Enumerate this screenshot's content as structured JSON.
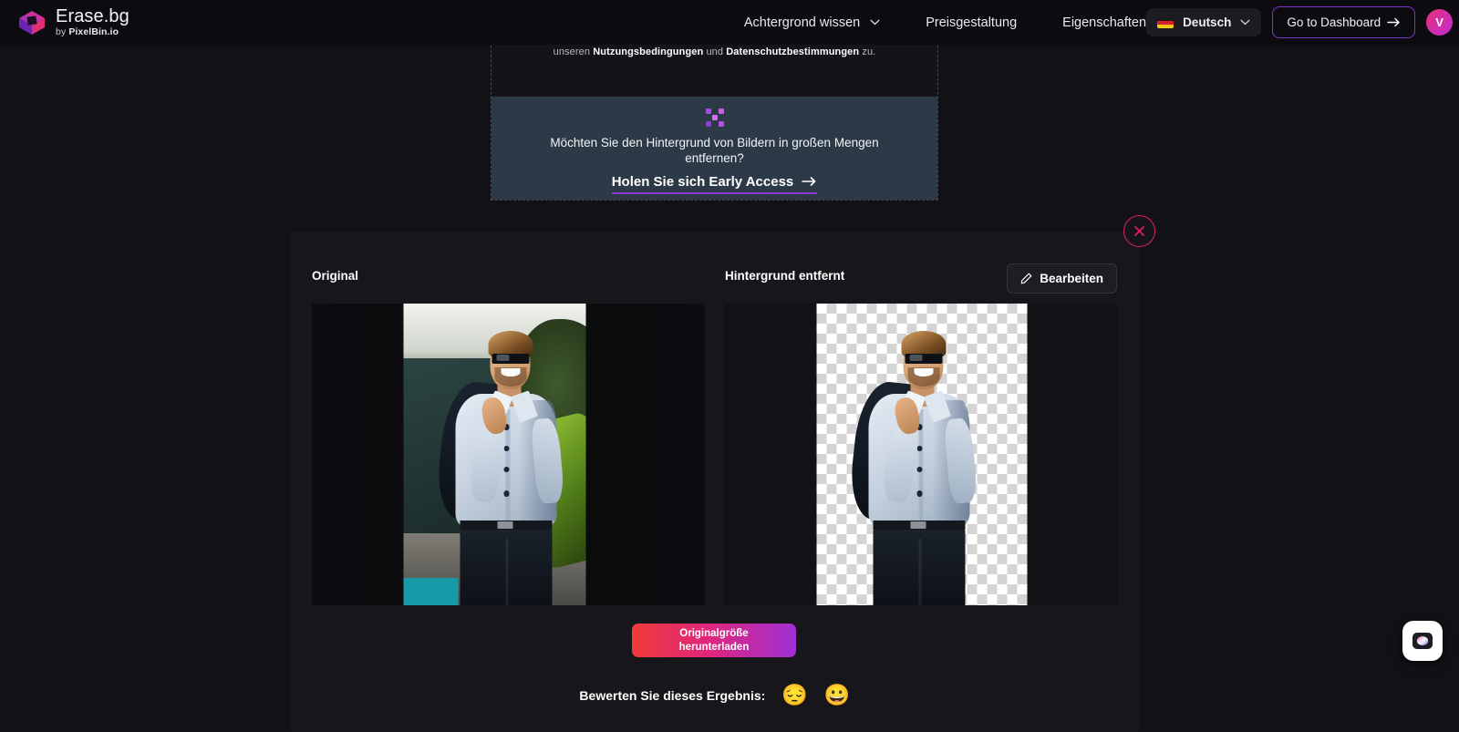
{
  "brand": {
    "name": "Erase.bg",
    "sub_prefix": "by ",
    "sub_name": "PixelBin.io",
    "logo_icon": "erasebg-logo-icon"
  },
  "nav": {
    "items": [
      {
        "label": "Achtergrond wissen",
        "has_dropdown": true,
        "icon": "chevron-down-icon"
      },
      {
        "label": "Preisgestaltung",
        "has_dropdown": false
      },
      {
        "label": "Eigenschaften",
        "has_dropdown": false
      }
    ]
  },
  "header_right": {
    "language": {
      "value": "Deutsch",
      "flag": "german-flag-icon",
      "chevron": "chevron-down-icon"
    },
    "dashboard_button": {
      "label": "Go to Dashboard",
      "icon": "arrow-right-icon",
      "border_color": "#7b35c4"
    },
    "avatar": {
      "initial": "V",
      "gradient_from": "#e8317b",
      "gradient_to": "#c02ad0"
    }
  },
  "dropzone": {
    "terms": {
      "prefix": "unseren ",
      "link_one": "Nutzungsbedingungen",
      "middle": " und ",
      "link_two": "Datenschutzbestimmungen",
      "suffix": " zu."
    },
    "bulk_card": {
      "icon": "bulk-squares-icon",
      "headline": "Möchten Sie den Hintergrund von Bildern in großen Mengen entfernen?",
      "cta_label": "Holen Sie sich Early Access",
      "cta_icon": "arrow-right-icon",
      "background_color": "#2c3a47",
      "underline_color": "#8b36d6"
    }
  },
  "result_panel": {
    "close_icon": "close-x-icon",
    "close_border_color": "#e31f63",
    "label_original": "Original",
    "label_removed": "Hintergrund entfernt",
    "edit_button": {
      "label": "Bearbeiten",
      "icon": "pencil-icon"
    },
    "download_button": {
      "line_one": "Originalgröße",
      "line_two": "herunterladen",
      "gradient_from": "#f03b3b",
      "gradient_to": "#a12fd4"
    },
    "rating": {
      "label": "Bewerten Sie dieses Ergebnis:",
      "options": [
        {
          "name": "rating-sad-emoji",
          "glyph": "😔"
        },
        {
          "name": "rating-happy-emoji",
          "glyph": "😀"
        }
      ]
    }
  },
  "chat_widget": {
    "icon": "chat-support-icon"
  }
}
